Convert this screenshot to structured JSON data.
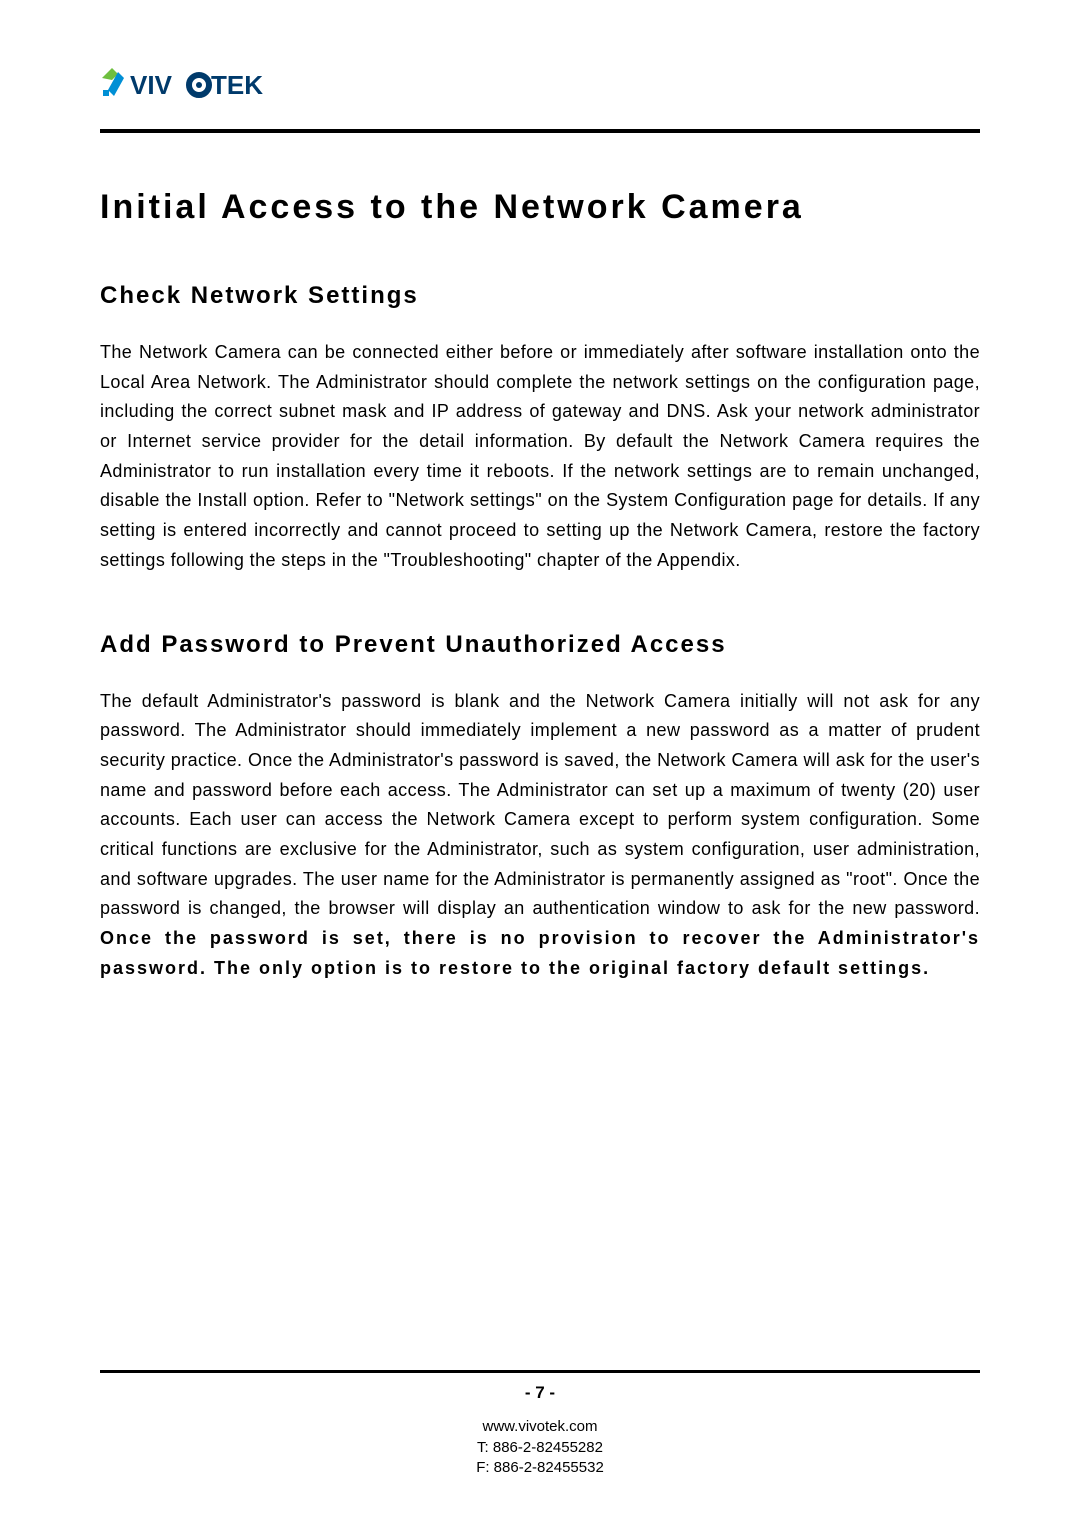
{
  "brand": {
    "name": "VIVOTEK"
  },
  "title": "Initial Access to the Network Camera",
  "sections": [
    {
      "heading": "Check Network Settings",
      "body": "The Network Camera can be connected either before or immediately after software installation onto the Local Area Network. The Administrator should complete the network settings on the configuration page, including the correct subnet mask and IP address of gateway and DNS. Ask your network administrator or Internet service provider for the detail information. By default the Network Camera requires the Administrator to run installation every time it reboots. If the network settings are to remain unchanged, disable the Install option. Refer to \"Network settings\" on the System Configuration page for details. If any setting is entered incorrectly and cannot proceed to setting up the Network Camera, restore the factory settings following the steps in the \"Troubleshooting\" chapter of the Appendix."
    },
    {
      "heading": "Add Password to Prevent Unauthorized Access",
      "body_main": "The default Administrator's password is blank and the Network Camera initially will not ask for any password. The Administrator should immediately implement a new password as a matter of prudent security practice. Once the Administrator's password is saved, the Network Camera will ask for the user's name and password before each access. The Administrator can set up a maximum of twenty (20) user accounts. Each user can access the Network Camera except to perform system configuration. Some critical functions are exclusive for the Administrator, such as system configuration, user administration, and software upgrades. The user name for the Administrator is permanently assigned as \"root\". Once the password is changed, the browser will display an authentication window to ask for the new password.  ",
      "body_bold": "Once the password is set, there is no provision to recover the Administrator's password.  The only option is to restore to the original factory default settings."
    }
  ],
  "footer": {
    "page_number": "- 7 -",
    "website": "www.vivotek.com",
    "tel": "T: 886-2-82455282",
    "fax": "F: 886-2-82455532"
  }
}
